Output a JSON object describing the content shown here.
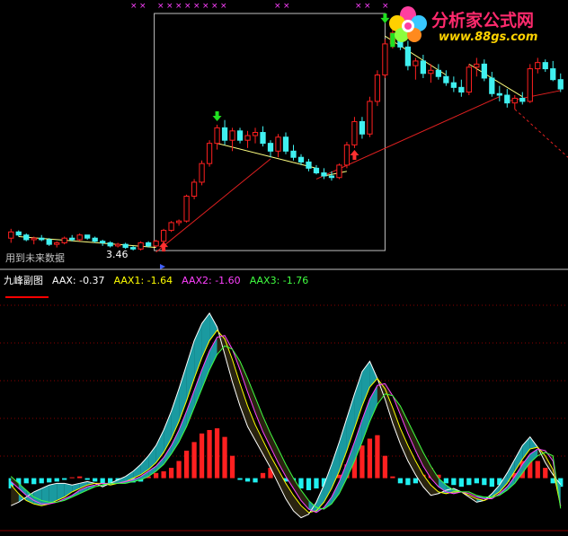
{
  "indicator": {
    "name": "九峰副图",
    "aax_label": "AAX: -0.37",
    "aax1_label": "AAX1: -1.64",
    "aax2_label": "AAX2: -1.60",
    "aax3_label": "AAX3: -1.76"
  },
  "logo": {
    "title": "分析家公式网",
    "url": "www.88gs.com"
  },
  "future_label": "用到未来数据",
  "price_label": "3.46",
  "colors": {
    "up": "#ff2020",
    "down": "#40f0f0",
    "trend": "#ffff80",
    "support": "#e02020",
    "teal": "#1a9aa0",
    "brown": "#2a2410",
    "aax": "#ffffff",
    "aax1": "#ffff00",
    "aax2": "#ff40ff",
    "aax3": "#40ff40",
    "grid": "#8a0000"
  },
  "chart_data": [
    {
      "type": "candlestick",
      "candles": [
        [
          11.8,
          12.4,
          11.5,
          12.2
        ],
        [
          12.2,
          12.3,
          11.9,
          12.0
        ],
        [
          12.0,
          12.1,
          11.6,
          11.7
        ],
        [
          11.7,
          11.9,
          11.4,
          11.8
        ],
        [
          11.8,
          12.0,
          11.6,
          11.7
        ],
        [
          11.7,
          11.8,
          11.3,
          11.4
        ],
        [
          11.4,
          11.6,
          11.2,
          11.5
        ],
        [
          11.5,
          11.9,
          11.4,
          11.8
        ],
        [
          11.8,
          12.0,
          11.6,
          11.7
        ],
        [
          11.7,
          12.1,
          11.6,
          12.0
        ],
        [
          12.0,
          12.0,
          11.7,
          11.8
        ],
        [
          11.8,
          11.9,
          11.5,
          11.6
        ],
        [
          11.6,
          11.7,
          11.3,
          11.5
        ],
        [
          11.5,
          11.6,
          11.2,
          11.3
        ],
        [
          11.3,
          11.5,
          11.2,
          11.4
        ],
        [
          11.4,
          11.5,
          11.1,
          11.2
        ],
        [
          11.2,
          11.3,
          11.0,
          11.1
        ],
        [
          11.1,
          11.6,
          11.0,
          11.5
        ],
        [
          11.5,
          11.6,
          11.2,
          11.3
        ],
        [
          11.3,
          11.7,
          11.2,
          11.6
        ],
        [
          11.6,
          12.4,
          11.5,
          12.3
        ],
        [
          12.3,
          12.9,
          12.2,
          12.8
        ],
        [
          12.8,
          13.0,
          12.6,
          12.9
        ],
        [
          12.9,
          14.6,
          12.8,
          14.5
        ],
        [
          14.5,
          15.6,
          14.3,
          15.4
        ],
        [
          15.4,
          16.8,
          15.2,
          16.6
        ],
        [
          16.6,
          18.1,
          16.4,
          17.9
        ],
        [
          17.9,
          19.1,
          17.5,
          18.9
        ],
        [
          18.9,
          19.4,
          17.8,
          18.1
        ],
        [
          18.1,
          18.9,
          17.4,
          18.7
        ],
        [
          18.7,
          18.9,
          17.9,
          18.1
        ],
        [
          18.1,
          18.7,
          17.6,
          18.4
        ],
        [
          18.4,
          18.9,
          17.9,
          18.6
        ],
        [
          18.6,
          19.0,
          17.7,
          17.9
        ],
        [
          17.9,
          18.1,
          17.0,
          17.4
        ],
        [
          17.4,
          18.5,
          17.0,
          18.3
        ],
        [
          18.3,
          18.6,
          17.2,
          17.4
        ],
        [
          17.4,
          17.8,
          16.8,
          17.0
        ],
        [
          17.0,
          17.2,
          16.5,
          16.7
        ],
        [
          16.7,
          16.9,
          16.1,
          16.3
        ],
        [
          16.3,
          16.5,
          15.9,
          16.0
        ],
        [
          16.0,
          16.3,
          15.6,
          15.8
        ],
        [
          15.8,
          16.1,
          15.5,
          15.7
        ],
        [
          15.7,
          16.6,
          15.6,
          16.5
        ],
        [
          16.5,
          18.0,
          16.3,
          17.8
        ],
        [
          17.8,
          19.6,
          17.6,
          19.3
        ],
        [
          19.3,
          19.6,
          18.2,
          18.5
        ],
        [
          18.5,
          20.9,
          18.3,
          20.6
        ],
        [
          20.6,
          22.6,
          20.3,
          22.3
        ],
        [
          22.3,
          24.6,
          22.1,
          24.3
        ],
        [
          24.3,
          25.6,
          24.0,
          25.0
        ],
        [
          25.0,
          25.3,
          23.9,
          24.1
        ],
        [
          24.1,
          24.5,
          22.6,
          22.9
        ],
        [
          22.9,
          23.4,
          22.0,
          23.2
        ],
        [
          23.2,
          23.6,
          22.1,
          22.4
        ],
        [
          22.4,
          23.0,
          21.8,
          22.6
        ],
        [
          22.6,
          23.0,
          22.0,
          22.2
        ],
        [
          22.2,
          22.6,
          21.6,
          21.8
        ],
        [
          21.8,
          22.2,
          21.2,
          21.5
        ],
        [
          21.5,
          22.0,
          20.9,
          21.2
        ],
        [
          21.2,
          23.0,
          21.0,
          22.8
        ],
        [
          22.8,
          23.4,
          22.2,
          23.0
        ],
        [
          23.0,
          23.3,
          21.9,
          22.1
        ],
        [
          22.1,
          22.5,
          20.9,
          21.1
        ],
        [
          21.1,
          21.6,
          20.6,
          21.0
        ],
        [
          21.0,
          21.4,
          20.2,
          20.5
        ],
        [
          20.5,
          21.0,
          20.1,
          20.8
        ],
        [
          20.8,
          21.2,
          20.4,
          20.6
        ],
        [
          20.6,
          23.0,
          20.5,
          22.7
        ],
        [
          22.7,
          23.4,
          22.4,
          23.1
        ],
        [
          23.1,
          23.3,
          22.5,
          22.7
        ],
        [
          22.7,
          23.2,
          21.9,
          22.0
        ],
        [
          22.0,
          22.4,
          21.2,
          21.4
        ]
      ],
      "trend_lines": [
        [
          [
            1,
            11.9
          ],
          [
            19,
            11.2
          ]
        ],
        [
          [
            27,
            17.9
          ],
          [
            40,
            16.3
          ]
        ],
        [
          [
            41,
            15.8
          ],
          [
            44,
            16.1
          ]
        ],
        [
          [
            49,
            24.8
          ],
          [
            57,
            22.3
          ]
        ],
        [
          [
            60,
            23.0
          ],
          [
            67,
            20.9
          ]
        ]
      ],
      "support_lines": [
        [
          [
            19,
            10.9
          ],
          [
            34,
            16.9
          ]
        ],
        [
          [
            40,
            15.6
          ],
          [
            64,
            20.9
          ]
        ],
        [
          [
            65,
            20.6
          ],
          [
            72,
            21.3
          ]
        ]
      ],
      "down_arrows": [
        [
          27,
          19.5
        ],
        [
          49,
          25.8
        ]
      ],
      "up_arrows": [
        [
          45,
          17.3
        ],
        [
          20,
          11.4
        ]
      ],
      "highlight_bar": [
        50,
        25.0,
        24.1
      ],
      "future_box": {
        "from": 19,
        "to": 49
      },
      "ylim": [
        10.6,
        26.2
      ]
    },
    {
      "type": "oscillator",
      "series": [
        {
          "name": "AAX",
          "values": [
            -1.6,
            -1.4,
            -1.1,
            -0.8,
            -0.6,
            -0.4,
            -0.3,
            -0.3,
            -0.4,
            -0.3,
            -0.2,
            -0.3,
            -0.5,
            -0.3,
            -0.1,
            0.1,
            0.4,
            0.8,
            1.3,
            1.9,
            2.8,
            3.9,
            5.2,
            6.6,
            8.0,
            9.0,
            9.6,
            8.8,
            7.2,
            5.6,
            4.2,
            3.0,
            2.2,
            1.4,
            0.6,
            -0.3,
            -1.2,
            -1.9,
            -2.3,
            -2.1,
            -1.4,
            -0.4,
            0.8,
            2.1,
            3.5,
            4.9,
            6.2,
            6.8,
            5.8,
            4.6,
            3.2,
            2.0,
            1.0,
            0.2,
            -0.5,
            -1.0,
            -0.9,
            -0.7,
            -0.6,
            -0.8,
            -1.1,
            -1.4,
            -1.3,
            -0.9,
            -0.4,
            0.3,
            1.1,
            1.9,
            2.4,
            1.8,
            0.9,
            0.2,
            -0.37
          ]
        },
        {
          "name": "AAX1",
          "values": [
            -0.4,
            -0.9,
            -1.3,
            -1.5,
            -1.6,
            -1.5,
            -1.3,
            -1.1,
            -0.8,
            -0.6,
            -0.4,
            -0.3,
            -0.3,
            -0.4,
            -0.3,
            -0.2,
            0.0,
            0.2,
            0.5,
            0.9,
            1.5,
            2.3,
            3.3,
            4.5,
            5.8,
            7.0,
            8.0,
            8.6,
            8.1,
            6.9,
            5.5,
            4.2,
            3.1,
            2.2,
            1.3,
            0.5,
            -0.3,
            -1.0,
            -1.6,
            -2.0,
            -1.9,
            -1.4,
            -0.6,
            0.4,
            1.6,
            2.9,
            4.2,
            5.3,
            5.8,
            5.2,
            4.1,
            2.9,
            1.9,
            1.0,
            0.2,
            -0.4,
            -0.8,
            -0.9,
            -0.8,
            -0.8,
            -1.0,
            -1.2,
            -1.3,
            -1.1,
            -0.8,
            -0.3,
            0.4,
            1.1,
            1.7,
            1.8,
            1.3,
            0.5,
            -1.64
          ]
        },
        {
          "name": "AAX2",
          "values": [
            -0.2,
            -0.6,
            -1.0,
            -1.3,
            -1.5,
            -1.5,
            -1.4,
            -1.2,
            -1.0,
            -0.7,
            -0.5,
            -0.4,
            -0.3,
            -0.3,
            -0.3,
            -0.2,
            -0.1,
            0.1,
            0.4,
            0.7,
            1.2,
            1.9,
            2.8,
            3.9,
            5.1,
            6.3,
            7.4,
            8.2,
            8.3,
            7.5,
            6.3,
            5.0,
            3.8,
            2.7,
            1.8,
            0.9,
            0.1,
            -0.6,
            -1.3,
            -1.8,
            -2.0,
            -1.7,
            -1.1,
            -0.2,
            0.9,
            2.1,
            3.4,
            4.6,
            5.4,
            5.5,
            4.8,
            3.7,
            2.6,
            1.6,
            0.7,
            0.0,
            -0.5,
            -0.8,
            -0.9,
            -0.8,
            -0.9,
            -1.1,
            -1.2,
            -1.2,
            -0.9,
            -0.5,
            0.1,
            0.8,
            1.4,
            1.7,
            1.6,
            1.0,
            -1.6
          ]
        },
        {
          "name": "AAX3",
          "values": [
            0.1,
            -0.3,
            -0.7,
            -1.1,
            -1.3,
            -1.4,
            -1.4,
            -1.3,
            -1.1,
            -0.9,
            -0.7,
            -0.5,
            -0.4,
            -0.3,
            -0.3,
            -0.3,
            -0.2,
            -0.1,
            0.1,
            0.4,
            0.8,
            1.4,
            2.1,
            3.0,
            4.1,
            5.2,
            6.3,
            7.2,
            7.7,
            7.5,
            6.8,
            5.8,
            4.7,
            3.6,
            2.6,
            1.7,
            0.8,
            0.0,
            -0.7,
            -1.3,
            -1.7,
            -1.8,
            -1.5,
            -0.9,
            0.0,
            1.0,
            2.1,
            3.3,
            4.3,
            4.9,
            4.8,
            4.2,
            3.3,
            2.4,
            1.5,
            0.7,
            0.0,
            -0.4,
            -0.7,
            -0.8,
            -0.8,
            -1.0,
            -1.1,
            -1.1,
            -1.0,
            -0.7,
            -0.3,
            0.3,
            0.9,
            1.3,
            1.5,
            1.3,
            -1.76
          ]
        }
      ],
      "histogram": [
        -0.6,
        -0.4,
        -0.3,
        -0.35,
        -0.3,
        -0.25,
        -0.2,
        -0.1,
        0.05,
        0.1,
        -0.1,
        -0.2,
        -0.3,
        -0.4,
        -0.3,
        -0.3,
        -0.25,
        -0.2,
        0.1,
        0.3,
        0.4,
        0.6,
        1.0,
        1.6,
        2.1,
        2.6,
        2.8,
        2.9,
        2.4,
        1.3,
        -0.1,
        -0.2,
        -0.25,
        0.3,
        0.6,
        0.3,
        -0.2,
        -0.4,
        -0.6,
        -0.7,
        -0.6,
        -0.5,
        -0.3,
        0.2,
        0.8,
        1.5,
        1.9,
        2.3,
        2.5,
        1.3,
        0.1,
        -0.3,
        -0.4,
        -0.3,
        0.2,
        0.6,
        0.2,
        -0.3,
        -0.4,
        -0.5,
        -0.4,
        -0.3,
        -0.4,
        -0.5,
        -0.4,
        -0.2,
        0.3,
        1.0,
        1.3,
        1.0,
        0.6,
        -0.3,
        -0.5
      ],
      "ylim": [
        -3.0,
        11.0
      ]
    }
  ]
}
